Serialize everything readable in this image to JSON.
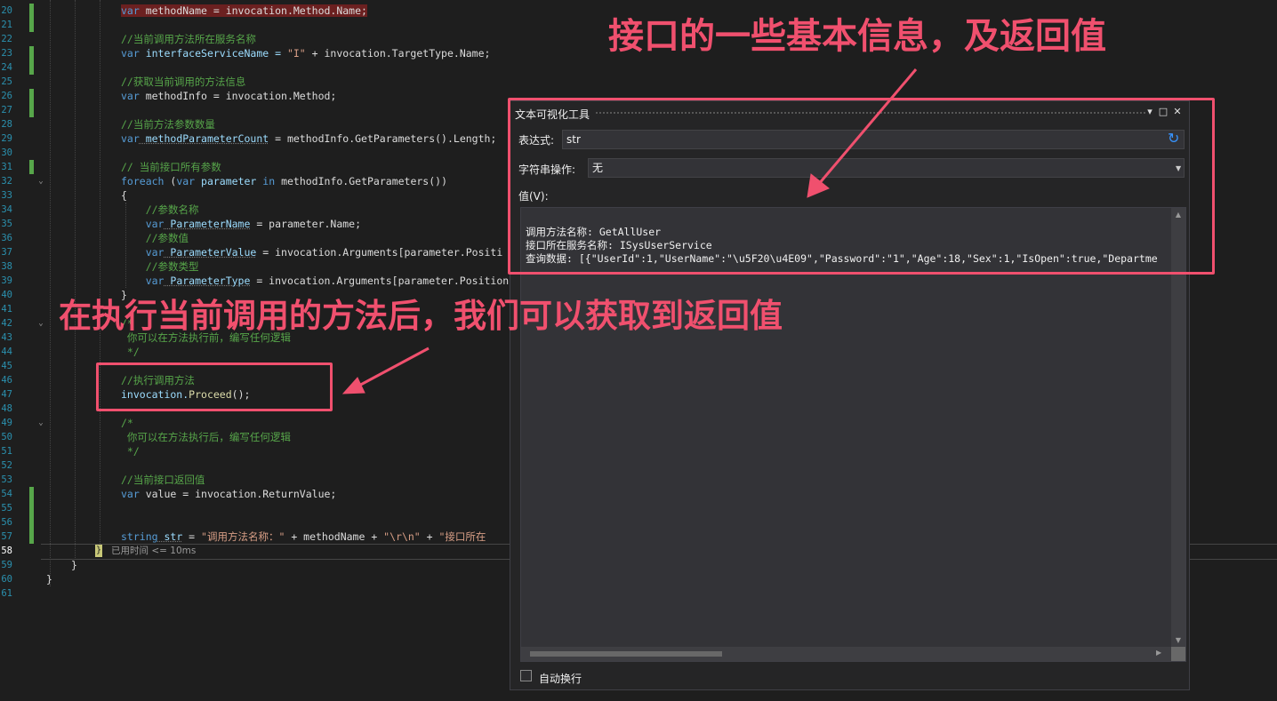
{
  "editor": {
    "lines": [
      {
        "n": "20",
        "segs": [
          [
            "var",
            "kw hl"
          ],
          [
            " methodName = invocation.Method.Name;",
            "pl hl"
          ]
        ]
      },
      {
        "n": "21",
        "segs": []
      },
      {
        "n": "22",
        "segs": [
          [
            "//当前调用方法所在服务名称",
            "cm"
          ]
        ]
      },
      {
        "n": "23",
        "segs": [
          [
            "var",
            "kw"
          ],
          [
            " interfaceServiceName = ",
            "vr"
          ],
          [
            "\"I\"",
            "st"
          ],
          [
            " + invocation.TargetType.Name;",
            "pl"
          ]
        ]
      },
      {
        "n": "24",
        "segs": []
      },
      {
        "n": "25",
        "segs": [
          [
            "//获取当前调用的方法信息",
            "cm"
          ]
        ]
      },
      {
        "n": "26",
        "segs": [
          [
            "var",
            "kw"
          ],
          [
            " methodInfo = invocation.Method;",
            "pl"
          ]
        ]
      },
      {
        "n": "27",
        "segs": []
      },
      {
        "n": "28",
        "segs": [
          [
            "//当前方法参数数量",
            "cm"
          ]
        ]
      },
      {
        "n": "29",
        "segs": [
          [
            "var",
            "kw"
          ],
          [
            " methodParameterCount",
            "pa"
          ],
          [
            " = methodInfo.GetParameters().Length;",
            "pl"
          ]
        ]
      },
      {
        "n": "30",
        "segs": []
      },
      {
        "n": "31",
        "segs": [
          [
            "// 当前接口所有参数",
            "cm"
          ]
        ]
      },
      {
        "n": "32",
        "segs": [
          [
            "foreach",
            "kw"
          ],
          [
            " (",
            "pl"
          ],
          [
            "var",
            "kw"
          ],
          [
            " parameter ",
            "vr"
          ],
          [
            "in",
            "kw"
          ],
          [
            " methodInfo.GetParameters())",
            "pl"
          ]
        ]
      },
      {
        "n": "33",
        "segs": [
          [
            "{",
            "pl"
          ]
        ]
      },
      {
        "n": "34",
        "segs": [
          [
            "    //参数名称",
            "cm"
          ]
        ]
      },
      {
        "n": "35",
        "segs": [
          [
            "    var",
            "kw"
          ],
          [
            " ParameterName",
            "pa"
          ],
          [
            " = parameter.Name;",
            "pl"
          ]
        ]
      },
      {
        "n": "36",
        "segs": [
          [
            "    //参数值",
            "cm"
          ]
        ]
      },
      {
        "n": "37",
        "segs": [
          [
            "    var",
            "kw"
          ],
          [
            " ParameterValue",
            "pa"
          ],
          [
            " = invocation.Arguments[parameter.Positi",
            "pl"
          ]
        ]
      },
      {
        "n": "38",
        "segs": [
          [
            "    //参数类型",
            "cm"
          ]
        ]
      },
      {
        "n": "39",
        "segs": [
          [
            "    var",
            "kw"
          ],
          [
            " ParameterType",
            "pa"
          ],
          [
            " = invocation.Arguments[parameter.Position",
            "pl"
          ]
        ]
      },
      {
        "n": "40",
        "segs": [
          [
            "}",
            "pl"
          ]
        ]
      },
      {
        "n": "41",
        "segs": []
      },
      {
        "n": "42",
        "segs": [
          [
            "/*",
            "cm"
          ]
        ]
      },
      {
        "n": "43",
        "segs": [
          [
            " 你可以在方法执行前，编写任何逻辑",
            "cm"
          ]
        ]
      },
      {
        "n": "44",
        "segs": [
          [
            " */",
            "cm"
          ]
        ]
      },
      {
        "n": "45",
        "segs": []
      },
      {
        "n": "46",
        "segs": [
          [
            "//执行调用方法",
            "cm"
          ]
        ]
      },
      {
        "n": "47",
        "segs": [
          [
            "invocation.",
            "vr"
          ],
          [
            "Proceed",
            "mt"
          ],
          [
            "();",
            "pl"
          ]
        ]
      },
      {
        "n": "48",
        "segs": []
      },
      {
        "n": "49",
        "segs": [
          [
            "/*",
            "cm"
          ]
        ]
      },
      {
        "n": "50",
        "segs": [
          [
            " 你可以在方法执行后，编写任何逻辑",
            "cm"
          ]
        ]
      },
      {
        "n": "51",
        "segs": [
          [
            " */",
            "cm"
          ]
        ]
      },
      {
        "n": "52",
        "segs": []
      },
      {
        "n": "53",
        "segs": [
          [
            "//当前接口返回值",
            "cm"
          ]
        ]
      },
      {
        "n": "54",
        "segs": [
          [
            "var",
            "kw"
          ],
          [
            " value = invocation.ReturnValue;",
            "pl"
          ]
        ]
      },
      {
        "n": "55",
        "segs": []
      },
      {
        "n": "56",
        "segs": []
      },
      {
        "n": "57",
        "segs": [
          [
            "string",
            "kw"
          ],
          [
            " str",
            "pa"
          ],
          [
            " = ",
            "pl"
          ],
          [
            "\"调用方法名称：\"",
            "st"
          ],
          [
            " + methodName + ",
            "pl"
          ],
          [
            "\"\\r\\n\"",
            "st"
          ],
          [
            " + ",
            "pl"
          ],
          [
            "\"接口所在",
            "st"
          ]
        ]
      },
      {
        "n": "58",
        "segs": []
      },
      {
        "n": "59",
        "segs": []
      },
      {
        "n": "60",
        "segs": []
      },
      {
        "n": "61",
        "segs": []
      }
    ],
    "closing_braces": [
      "}",
      "}",
      "}"
    ],
    "elapsed_text": "已用时间 <= 10ms"
  },
  "visualizer": {
    "title": "文本可视化工具",
    "menu_icon": "chevron-down-icon",
    "maximize_icon": "□",
    "close_icon": "✕",
    "expression_label": "表达式:",
    "expression_value": "str",
    "string_op_label": "字符串操作:",
    "string_op_value": "无",
    "value_label": "值(V):",
    "value_lines": [
      "调用方法名称: GetAllUser",
      "接口所在服务名称: ISysUserService",
      "查询数据: [{\"UserId\":1,\"UserName\":\"\\u5F20\\u4E09\",\"Password\":\"1\",\"Age\":18,\"Sex\":1,\"IsOpen\":true,\"Departme"
    ],
    "wrap_label": "自动换行"
  },
  "annotations": {
    "top_text": "接口的一些基本信息，及返回值",
    "middle_text": "在执行当前调用的方法后，我们可以获取到返回值",
    "accent_color": "#f0506e"
  }
}
